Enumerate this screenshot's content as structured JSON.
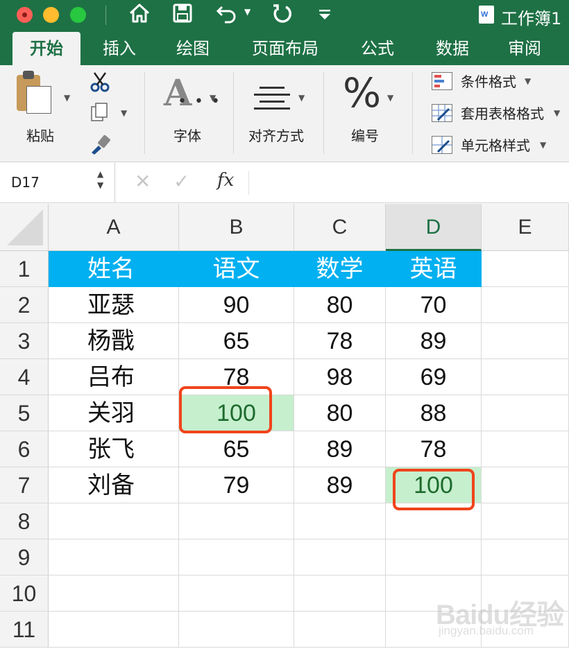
{
  "window": {
    "title": "工作簿1",
    "toolbar_icons": [
      "home-icon",
      "save-icon",
      "undo-icon",
      "redo-icon",
      "customize-icon"
    ]
  },
  "tabs": [
    {
      "label": "开始",
      "active": true
    },
    {
      "label": "插入"
    },
    {
      "label": "绘图"
    },
    {
      "label": "页面布局"
    },
    {
      "label": "公式"
    },
    {
      "label": "数据"
    },
    {
      "label": "审阅"
    }
  ],
  "ribbon": {
    "paste_label": "粘贴",
    "font_label": "字体",
    "align_label": "对齐方式",
    "number_label": "编号",
    "number_glyph": "%",
    "font_glyph": "A",
    "conditional_format": "条件格式",
    "table_format": "套用表格格式",
    "cell_style": "单元格样式"
  },
  "formula_bar": {
    "name_box": "D17",
    "fx": "fx",
    "content": ""
  },
  "sheet": {
    "columns": [
      "A",
      "B",
      "C",
      "D",
      "E"
    ],
    "selected_column": "D",
    "rows": [
      "1",
      "2",
      "3",
      "4",
      "5",
      "6",
      "7",
      "8",
      "9",
      "10",
      "11"
    ],
    "table": [
      [
        "姓名",
        "语文",
        "数学",
        "英语"
      ],
      [
        "亚瑟",
        "90",
        "80",
        "70"
      ],
      [
        "杨戬",
        "65",
        "78",
        "89"
      ],
      [
        "吕布",
        "78",
        "98",
        "69"
      ],
      [
        "关羽",
        "100",
        "80",
        "88"
      ],
      [
        "张飞",
        "65",
        "89",
        "78"
      ],
      [
        "刘备",
        "79",
        "89",
        "100"
      ]
    ],
    "header_color": "#00b0f0",
    "highlight_color": "#c6efce",
    "callout_color": "#f0441b",
    "highlighted_cells": [
      "B5",
      "D7"
    ]
  },
  "watermark": {
    "text": "Baidu经验",
    "sub": "jingyan.baidu.com"
  }
}
